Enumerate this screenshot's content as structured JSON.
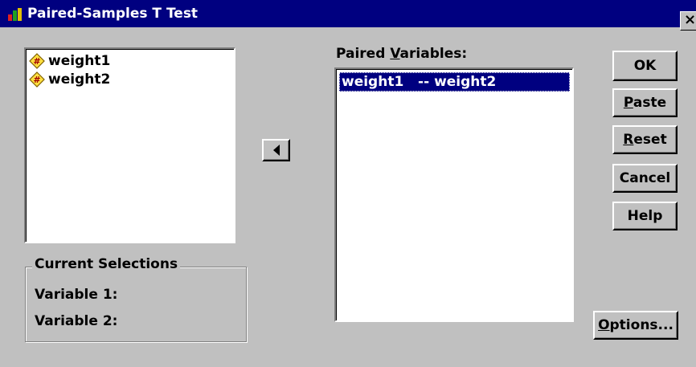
{
  "window": {
    "title": "Paired-Samples T Test",
    "close_glyph": "×"
  },
  "source_list": {
    "items": [
      {
        "name": "weight1",
        "icon": "numeric-variable-icon"
      },
      {
        "name": "weight2",
        "icon": "numeric-variable-icon"
      }
    ]
  },
  "move_button": {
    "icon": "left-arrow-icon"
  },
  "paired_variables": {
    "label_before": "Paired ",
    "label_underlined": "V",
    "label_after": "ariables:",
    "pairs": [
      {
        "text": "weight1   -- weight2"
      }
    ]
  },
  "current_selections": {
    "title": "Current Selections",
    "variable1_label": "Variable 1:",
    "variable2_label": "Variable 2:"
  },
  "buttons": {
    "ok": {
      "label": "OK"
    },
    "paste": {
      "underlined": "P",
      "rest": "aste"
    },
    "reset": {
      "underlined": "R",
      "rest": "eset"
    },
    "cancel": {
      "label": "Cancel"
    },
    "help": {
      "label": "Help"
    },
    "options": {
      "underlined": "O",
      "rest": "ptions..."
    }
  },
  "colors": {
    "dialog_bg": "#c0c0c0",
    "titlebar_bg": "#000080",
    "selection_bg": "#000080",
    "list_bg": "#ffffff"
  }
}
